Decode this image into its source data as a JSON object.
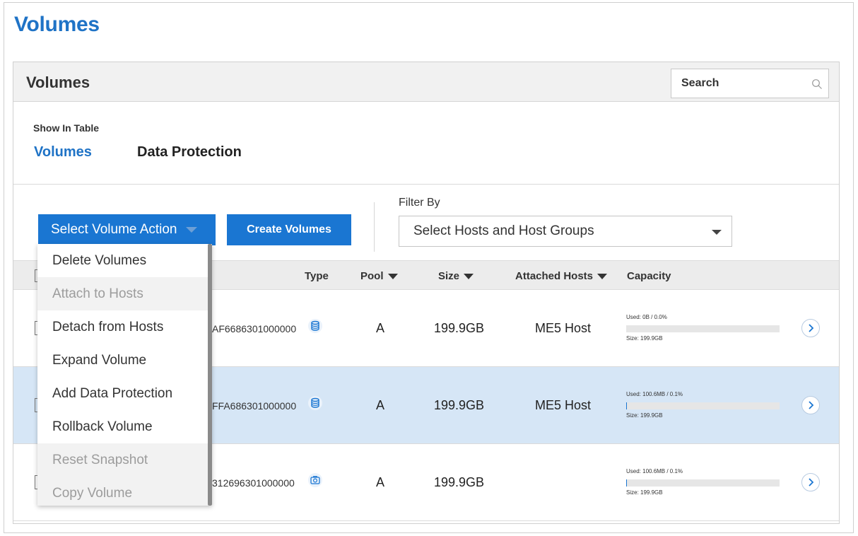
{
  "page": {
    "title": "Volumes"
  },
  "panel": {
    "title": "Volumes",
    "search_placeholder": "Search",
    "show_in_table_label": "Show In Table",
    "tabs": [
      {
        "label": "Volumes",
        "active": true
      },
      {
        "label": "Data Protection",
        "active": false
      }
    ]
  },
  "toolbar": {
    "action_label": "Select Volume Action",
    "create_label": "Create Volumes",
    "filter_label": "Filter By",
    "filter_value": "Select Hosts and Host Groups"
  },
  "table": {
    "headers": {
      "type": "Type",
      "pool": "Pool",
      "size": "Size",
      "attached_hosts": "Attached Hosts",
      "capacity": "Capacity"
    },
    "rows": [
      {
        "name": "AF6686301000000",
        "type_icon": "database-icon",
        "pool": "A",
        "size": "199.9GB",
        "attached_hosts": "ME5 Host",
        "used": "Used: 0B / 0.0%",
        "used_fraction": 0.0,
        "cap_size": "Size: 199.9GB",
        "selected": false
      },
      {
        "name": "FFA686301000000",
        "type_icon": "database-icon",
        "pool": "A",
        "size": "199.9GB",
        "attached_hosts": "ME5 Host",
        "used": "Used: 100.6MB / 0.1%",
        "used_fraction": 0.001,
        "cap_size": "Size: 199.9GB",
        "selected": true
      },
      {
        "name": "312696301000000",
        "type_icon": "snapshot-icon",
        "pool": "A",
        "size": "199.9GB",
        "attached_hosts": "",
        "used": "Used: 100.6MB / 0.1%",
        "used_fraction": 0.001,
        "cap_size": "Size: 199.9GB",
        "selected": false
      }
    ]
  },
  "menu": {
    "items": [
      {
        "label": "Delete Volumes",
        "enabled": true
      },
      {
        "label": "Attach to Hosts",
        "enabled": false
      },
      {
        "label": "Detach from Hosts",
        "enabled": true
      },
      {
        "label": "Expand Volume",
        "enabled": true
      },
      {
        "label": "Add Data Protection",
        "enabled": true
      },
      {
        "label": "Rollback Volume",
        "enabled": true
      },
      {
        "label": "Reset Snapshot",
        "enabled": false
      },
      {
        "label": "Copy Volume",
        "enabled": false
      }
    ]
  },
  "colors": {
    "accent": "#1a76d2",
    "title": "#1f73c6",
    "selected_row": "#d6e6f6"
  }
}
